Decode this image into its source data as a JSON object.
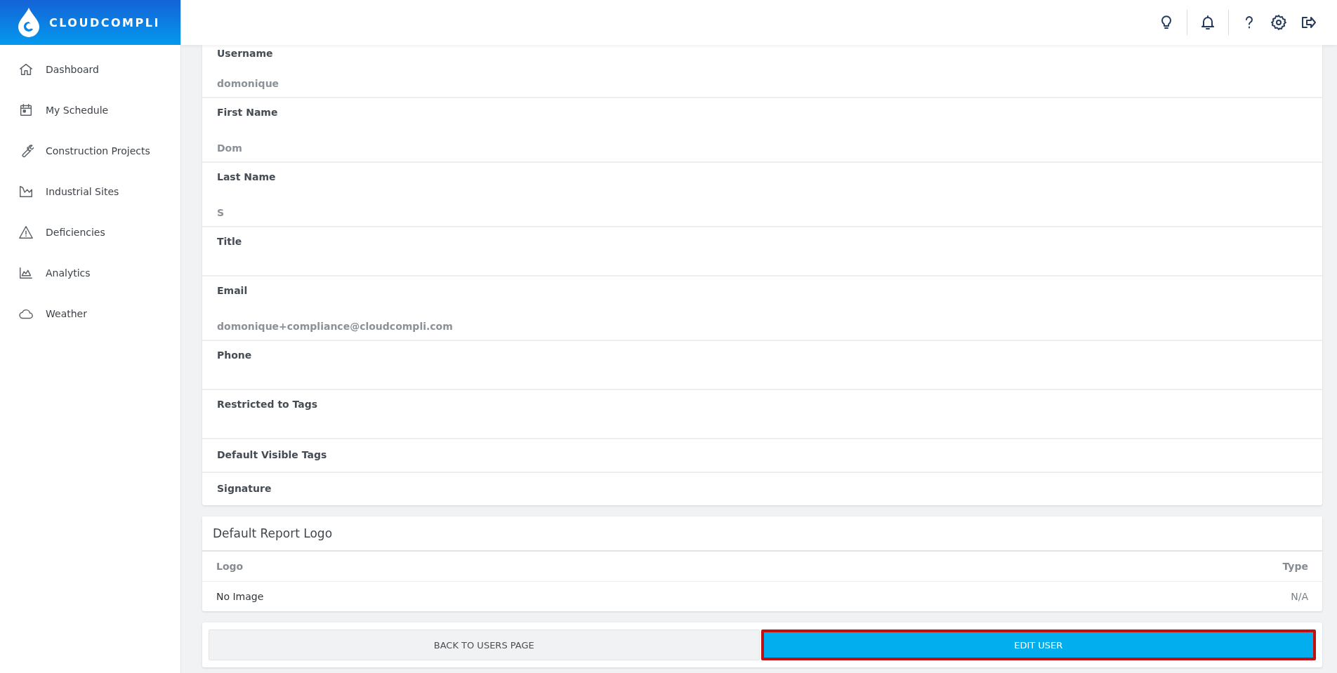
{
  "brand": {
    "name": "CLOUDCOMPLI"
  },
  "sidebar": {
    "items": [
      {
        "label": "Dashboard",
        "selected": false
      },
      {
        "label": "My Schedule",
        "selected": false
      },
      {
        "label": "Construction Projects",
        "selected": false
      },
      {
        "label": "Industrial Sites",
        "selected": false
      },
      {
        "label": "Deficiencies",
        "selected": false
      },
      {
        "label": "Analytics",
        "selected": false
      },
      {
        "label": "Weather",
        "selected": false
      }
    ]
  },
  "user_details": {
    "fields": [
      {
        "kind": "text",
        "label": "Username",
        "value": "domonique"
      },
      {
        "kind": "text",
        "label": "First Name",
        "value": "Dom"
      },
      {
        "kind": "text",
        "label": "Last Name",
        "value": "S"
      },
      {
        "kind": "text",
        "label": "Title"
      },
      {
        "kind": "text",
        "label": "Email",
        "value": "domonique+compliance@cloudcompli.com"
      },
      {
        "kind": "text",
        "label": "Phone"
      },
      {
        "kind": "text",
        "label": "Restricted to Tags"
      },
      {
        "kind": "compact",
        "label": "Default Visible Tags"
      },
      {
        "kind": "compact",
        "label": "Signature"
      }
    ]
  },
  "report_logo": {
    "title": "Default Report Logo",
    "columns": [
      "Logo",
      "Type"
    ],
    "rows": [
      [
        "No Image",
        "N/A"
      ]
    ]
  },
  "buttons": [
    {
      "label": "BACK TO USERS PAGE",
      "kind": "secondary",
      "highlighted": false
    },
    {
      "label": "EDIT USER",
      "kind": "primary",
      "highlighted": true
    }
  ]
}
